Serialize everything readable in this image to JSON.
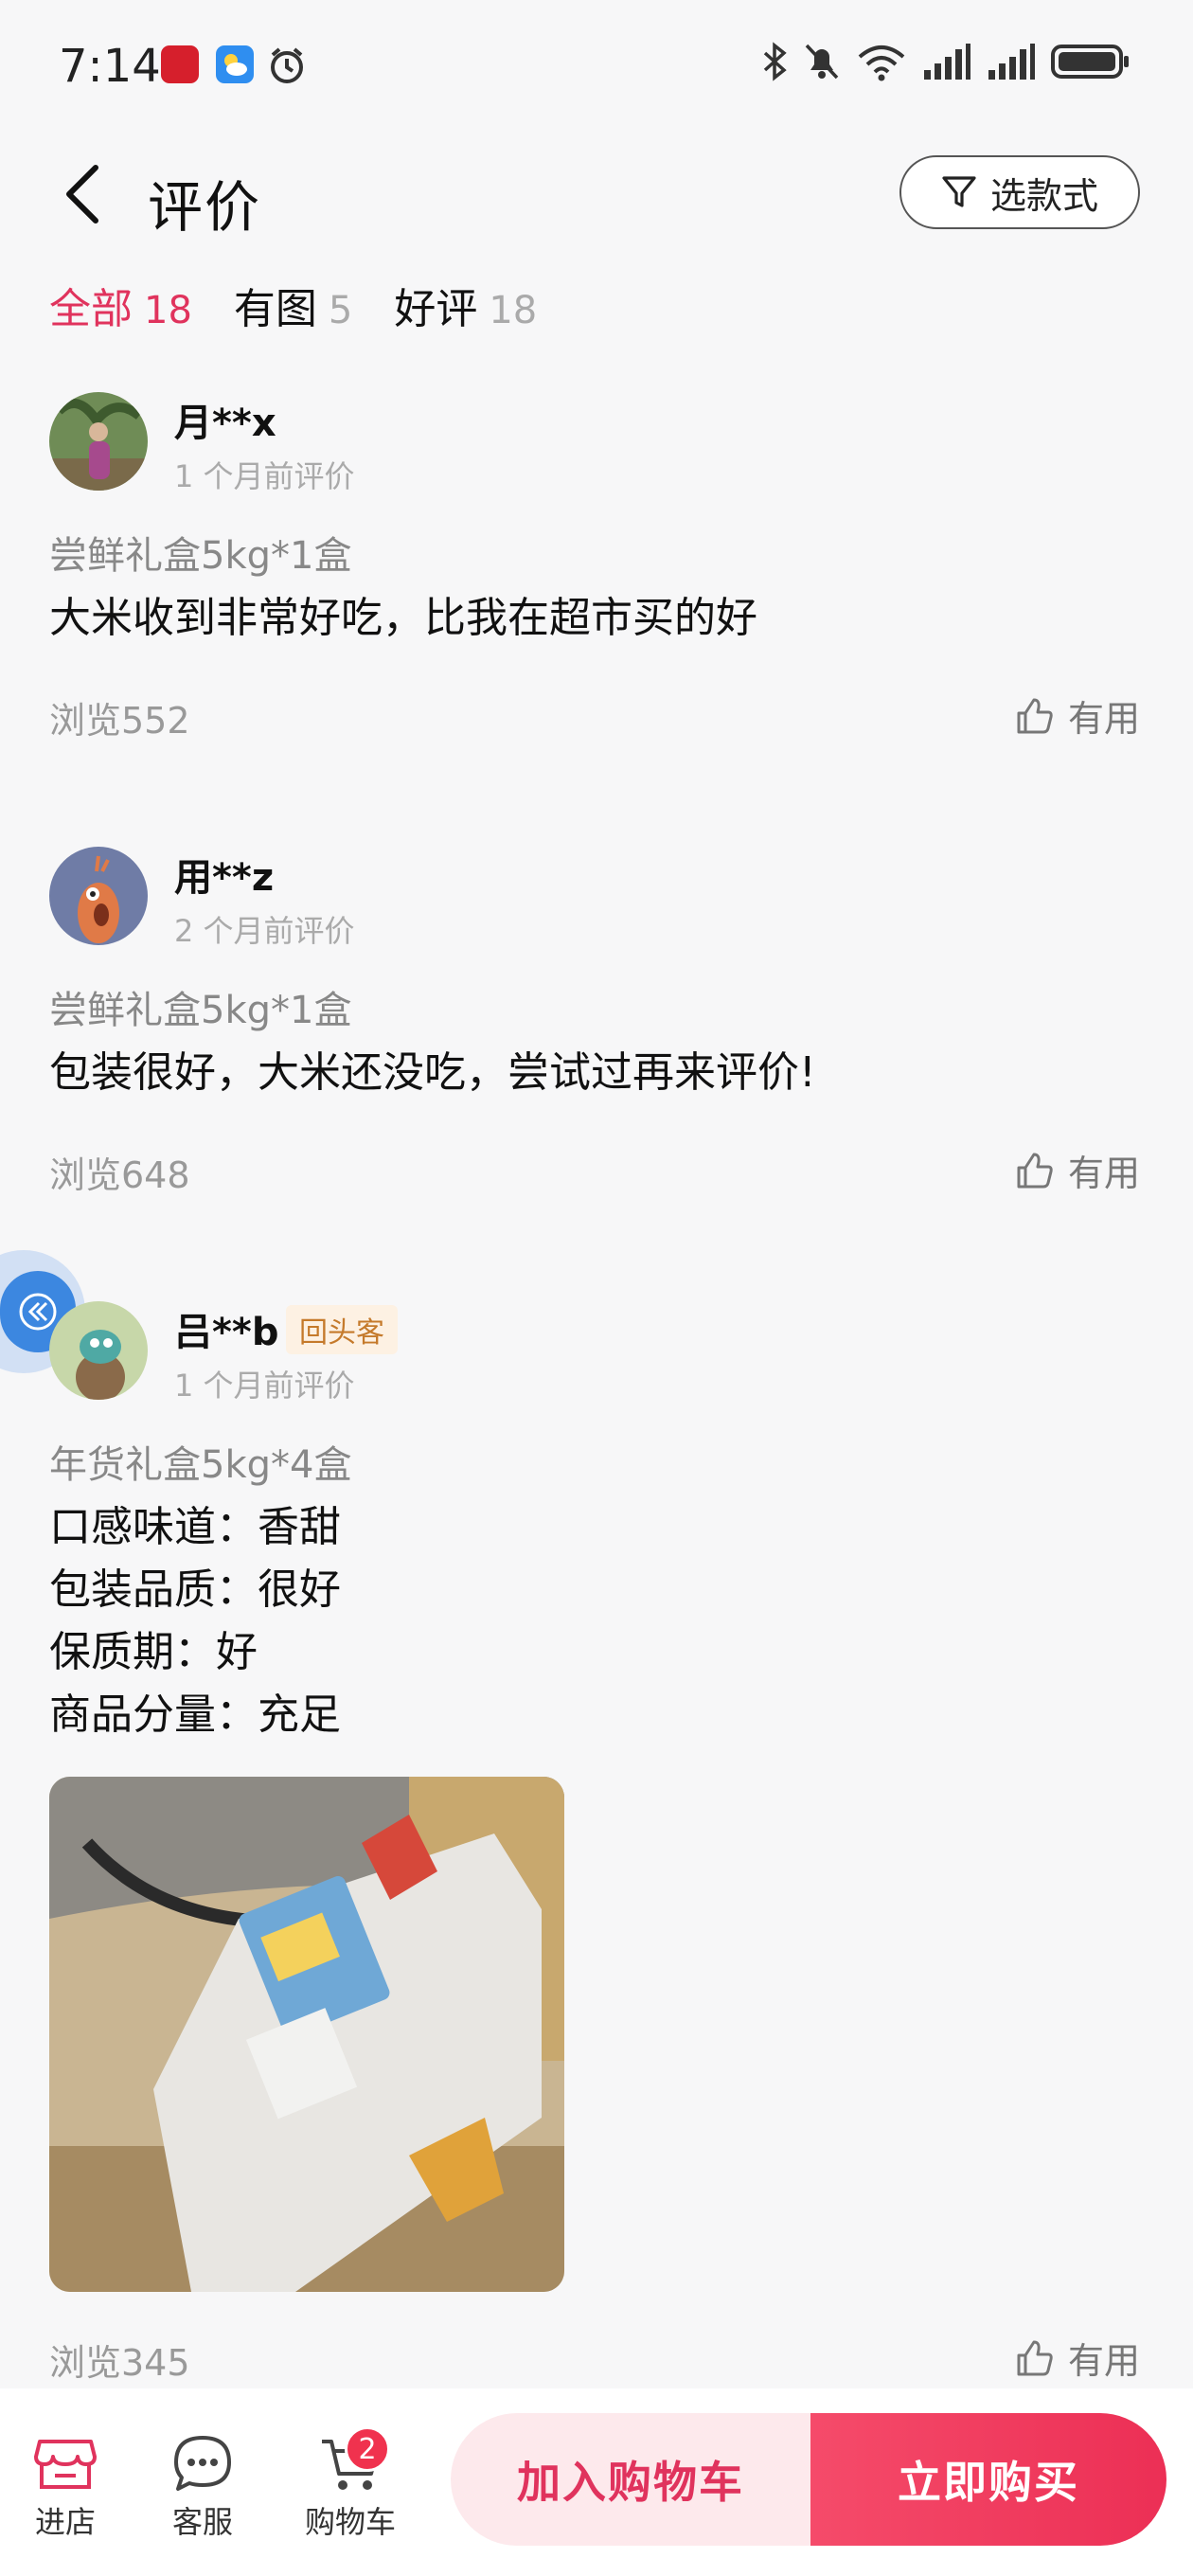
{
  "status_bar": {
    "time": "7:14"
  },
  "header": {
    "title": "评价",
    "filter_label": "选款式"
  },
  "tabs": [
    {
      "label": "全部",
      "count": "18"
    },
    {
      "label": "有图",
      "count": "5"
    },
    {
      "label": "好评",
      "count": "18"
    }
  ],
  "reviews": [
    {
      "user": "月**x",
      "time": "1 个月前评价",
      "sku": "尝鲜礼盒5kg*1盒",
      "content": "大米收到非常好吃，比我在超市买的好",
      "views": "浏览552",
      "useful": "有用"
    },
    {
      "user": "用**z",
      "time": "2 个月前评价",
      "sku": "尝鲜礼盒5kg*1盒",
      "content": "包装很好，大米还没吃，尝试过再来评价!",
      "views": "浏览648",
      "useful": "有用"
    },
    {
      "user": "吕**b",
      "badge": "回头客",
      "time": "1 个月前评价",
      "sku": "年货礼盒5kg*4盒",
      "content_lines": [
        "口感味道：香甜",
        "包装品质：很好",
        "保质期：好",
        "商品分量：充足"
      ],
      "views": "浏览345",
      "useful": "有用"
    }
  ],
  "bottom_bar": {
    "store_label": "进店",
    "service_label": "客服",
    "cart_label": "购物车",
    "cart_count": "2",
    "add_to_cart": "加入购物车",
    "buy_now": "立即购买"
  },
  "colors": {
    "accent": "#e0335d",
    "buy_button": "#ec2f55",
    "badge_text": "#c57a2b",
    "float_button": "#3c87e0"
  }
}
